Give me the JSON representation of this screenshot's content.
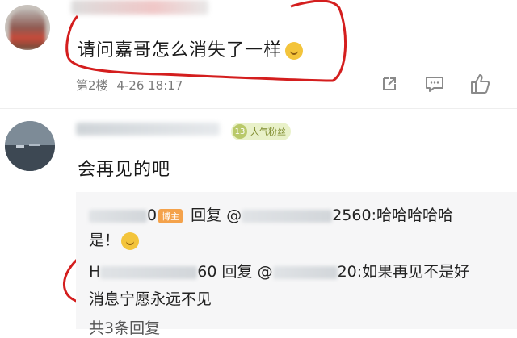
{
  "comments": [
    {
      "text": "请问嘉哥怎么消失了一样",
      "floor": "第2楼",
      "datetime": "4-26 18:17"
    },
    {
      "fan_level": "13",
      "fan_badge": "人气粉丝",
      "text": "会再见的吧",
      "replies": [
        {
          "name_suffix": "0",
          "role_tag": "博主",
          "verb": "回复",
          "at_prefix": "@",
          "at_suffix": "2560",
          "content": ":哈哈哈哈哈",
          "content_wrap": "是！"
        },
        {
          "name_prefix": "H",
          "name_suffix": "60",
          "verb": "回复",
          "at_prefix": "@",
          "at_suffix": "20",
          "content": ":如果再见不是好",
          "content_wrap": "消息宁愿永远不见"
        }
      ],
      "more_replies": "共3条回复"
    }
  ],
  "annotation_color": "#d41e1e"
}
